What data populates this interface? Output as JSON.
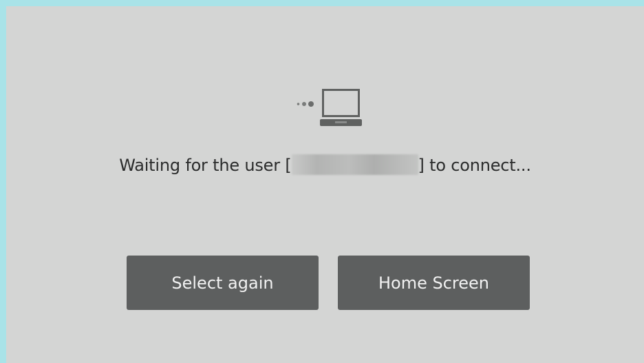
{
  "icon": "laptop-connecting-icon",
  "message": {
    "prefix": "Waiting for the user [",
    "suffix": "] to connect..."
  },
  "buttons": {
    "select_again": "Select again",
    "home_screen": "Home Screen"
  },
  "colors": {
    "outer_border": "#a9e3e8",
    "panel_background": "#d4d5d4",
    "button_background": "#5d5f5f",
    "button_text": "#f2f2f2",
    "message_text": "#2b2c2c",
    "icon": "#6b6d6c"
  }
}
